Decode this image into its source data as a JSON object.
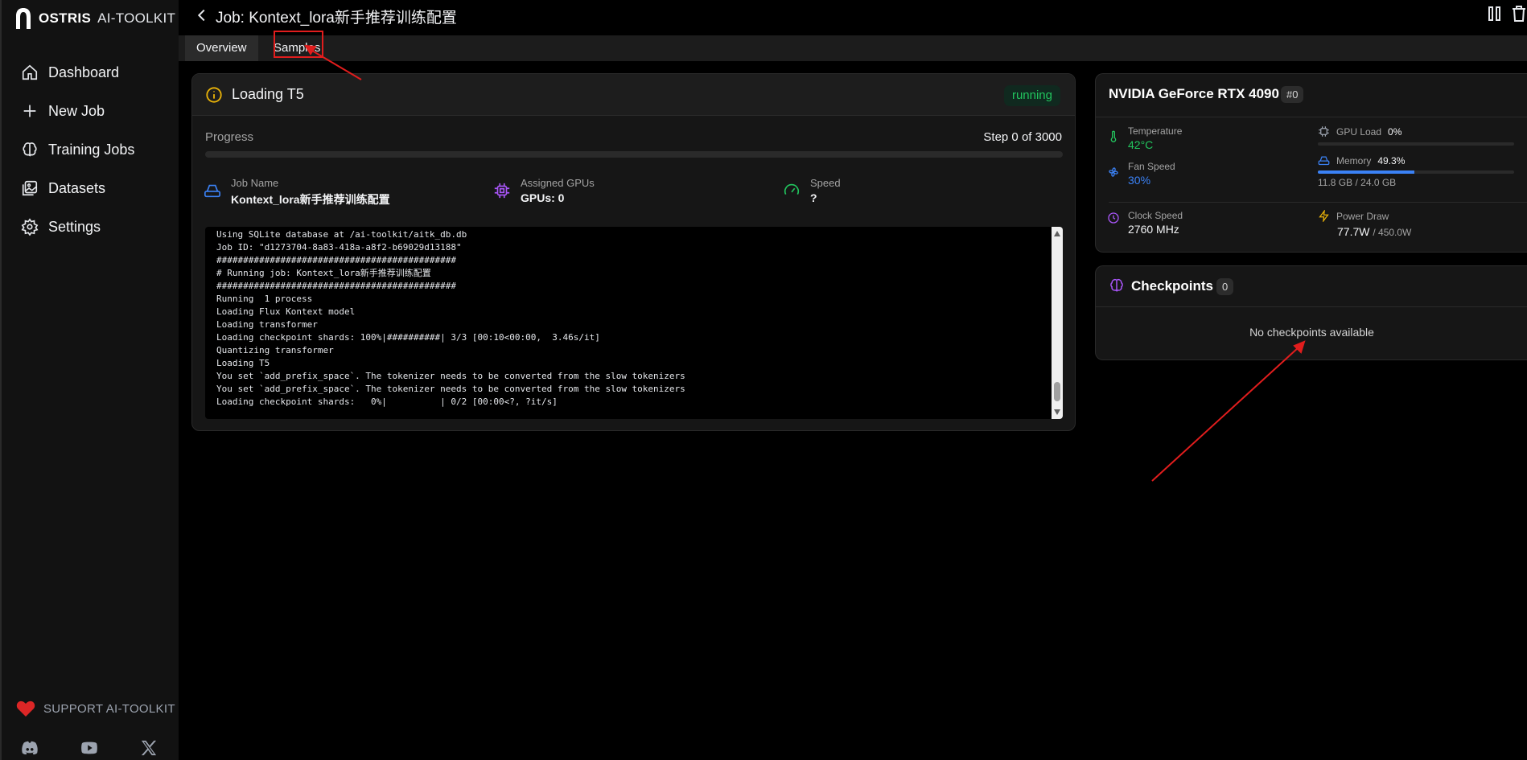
{
  "app": {
    "brand_bold": "OSTRIS",
    "brand_light": "AI-TOOLKIT"
  },
  "sidebar": {
    "items": [
      {
        "label": "Dashboard",
        "icon": "home-icon"
      },
      {
        "label": "New Job",
        "icon": "plus-icon"
      },
      {
        "label": "Training Jobs",
        "icon": "brain-icon"
      },
      {
        "label": "Datasets",
        "icon": "images-icon"
      },
      {
        "label": "Settings",
        "icon": "gear-icon"
      }
    ],
    "support_label": "SUPPORT AI-TOOLKIT",
    "social": [
      "discord-icon",
      "youtube-icon",
      "x-icon"
    ]
  },
  "header": {
    "title": "Job: Kontext_lora新手推荐训练配置"
  },
  "tabs": [
    {
      "label": "Overview",
      "active": true
    },
    {
      "label": "Samples",
      "active": false
    }
  ],
  "status": {
    "title": "Loading T5",
    "badge": "running",
    "progress_label": "Progress",
    "progress_step": "Step 0 of 3000",
    "progress_fraction": 0,
    "job_name_label": "Job Name",
    "job_name": "Kontext_lora新手推荐训练配置",
    "gpus_label": "Assigned GPUs",
    "gpus": "GPUs: 0",
    "speed_label": "Speed",
    "speed": "?"
  },
  "log": [
    "Using SQLite database at /ai-toolkit/aitk_db.db",
    "Job ID: \"d1273704-8a83-418a-a8f2-b69029d13188\"",
    "#############################################",
    "# Running job: Kontext_lora新手推荐训练配置",
    "#############################################",
    "Running  1 process",
    "Loading Flux Kontext model",
    "Loading transformer",
    "Loading checkpoint shards: 100%|##########| 3/3 [00:10<00:00,  3.46s/it]",
    "Quantizing transformer",
    "Loading T5",
    "You set `add_prefix_space`. The tokenizer needs to be converted from the slow tokenizers",
    "You set `add_prefix_space`. The tokenizer needs to be converted from the slow tokenizers",
    "Loading checkpoint shards:   0%|          | 0/2 [00:00<?, ?it/s]"
  ],
  "gpu": {
    "name": "NVIDIA GeForce RTX 4090",
    "index": "#0",
    "temperature_label": "Temperature",
    "temperature": "42°C",
    "fan_label": "Fan Speed",
    "fan": "30%",
    "clock_label": "Clock Speed",
    "clock": "2760 MHz",
    "load_label": "GPU Load",
    "load": "0%",
    "load_fraction": 0,
    "memory_label": "Memory",
    "memory": "49.3%",
    "memory_fraction": 0.493,
    "memory_detail": "11.8 GB / 24.0 GB",
    "power_label": "Power Draw",
    "power": "77.7W",
    "power_max": "/ 450.0W"
  },
  "checkpoints": {
    "title": "Checkpoints",
    "count": "0",
    "empty": "No checkpoints available"
  },
  "colors": {
    "accent": "#3b82f6",
    "running": "#22c55e",
    "warning": "#eab308",
    "purple": "#a855f7",
    "annotation": "#e11d1d"
  }
}
